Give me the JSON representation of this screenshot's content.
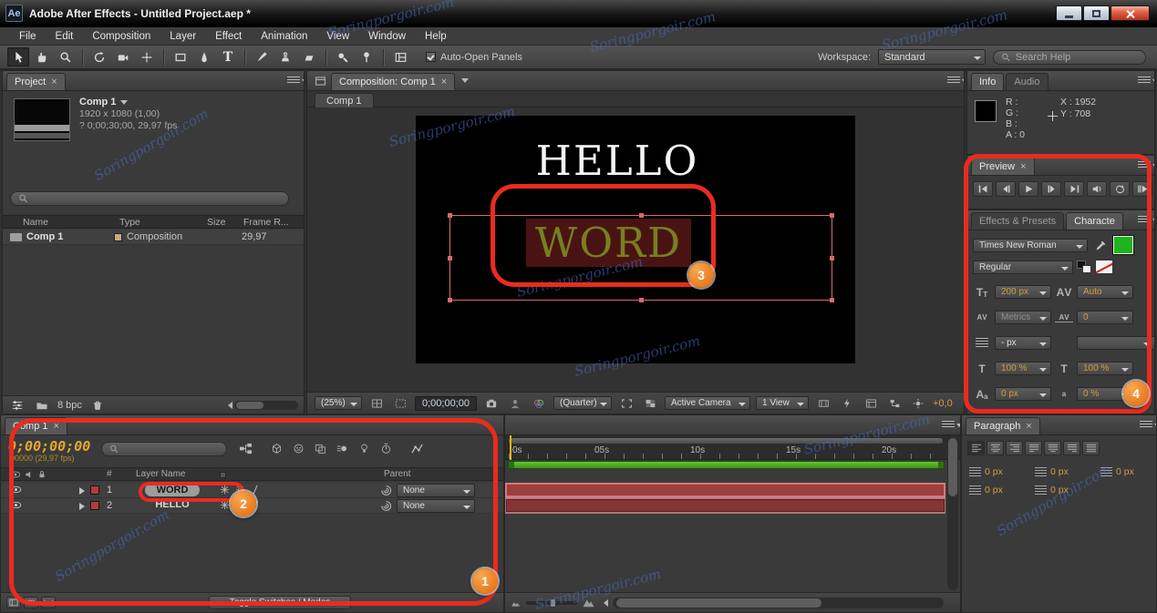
{
  "ui": {
    "close": "×"
  },
  "window": {
    "badge": "Ae",
    "title": "Adobe After Effects - Untitled Project.aep *"
  },
  "menu": {
    "items": [
      "File",
      "Edit",
      "Composition",
      "Layer",
      "Effect",
      "Animation",
      "View",
      "Window",
      "Help"
    ]
  },
  "toolbar": {
    "text_tool": "T",
    "auto_open_label": "Auto-Open Panels",
    "workspace_label": "Workspace:",
    "workspace_value": "Standard",
    "search_placeholder": "Search Help"
  },
  "project": {
    "tab": "Project",
    "comp_name": "Comp 1",
    "detail1": "1920 x 1080 (1,00)",
    "detail2": "? 0;00;30;00, 29,97 fps",
    "col_name": "Name",
    "col_type": "Type",
    "col_size": "Size",
    "col_frame": "Frame R...",
    "row_name": "Comp 1",
    "row_type": "Composition",
    "row_frame_rate": "29,97",
    "bpc": "8 bpc"
  },
  "comp": {
    "tab": "Composition: Comp 1",
    "subtab": "Comp 1",
    "hello": "HELLO",
    "word": "WORD",
    "zoom": "(25%)",
    "timecode": "0;00;00;00",
    "resolution": "(Quarter)",
    "camera": "Active Camera",
    "view": "1 View",
    "exposure": "+0,0"
  },
  "info": {
    "tab": "Info",
    "tab_audio": "Audio",
    "r": "R :",
    "g": "G :",
    "b": "B :",
    "a": "A : 0",
    "x": "X : 1952",
    "y": "Y : 708"
  },
  "preview": {
    "tab": "Preview"
  },
  "character": {
    "tab_effects": "Effects & Presets",
    "tab": "Characte",
    "font_family": "Times New Roman",
    "font_style": "Regular",
    "font_size": "200 px",
    "kerning": "Auto",
    "tracking_mode": "Metrics",
    "tracking": "0",
    "leading": "- px",
    "vertical_scale": "100 %",
    "horizontal_scale": "100 %",
    "baseline_shift": "0 px",
    "tsume": "0 %",
    "icon_t": "T",
    "icon_a": "A",
    "icon_v": "V",
    "icon_a_small": "a"
  },
  "paragraph": {
    "tab": "Paragraph",
    "values": [
      "0 px",
      "0 px",
      "0 px",
      "0 px",
      "0 px"
    ]
  },
  "timeline": {
    "tab": "Comp 1",
    "timecode": "0;00;00;00",
    "frames": "00000 (29,97 fps)",
    "col_hash": "#",
    "col_layer_name": "Layer Name",
    "col_parent": "Parent",
    "layers": [
      {
        "num": "1",
        "name": "WORD",
        "parent": "None"
      },
      {
        "num": "2",
        "name": "HELLO",
        "parent": "None"
      }
    ],
    "toggle_label": "Toggle Switches / Modes",
    "ruler": [
      "0s",
      "05s",
      "10s",
      "15s",
      "20s"
    ]
  },
  "annotations": {
    "n1": "1",
    "n2": "2",
    "n3": "3",
    "n4": "4"
  },
  "watermark": "Soringporgoir.com",
  "colors": {
    "annotation": "#ea2b1f",
    "badge": "#ee8330",
    "word_fill": "#76801f",
    "word_selection": "#4a1313",
    "work_area_green": "#4fae24"
  }
}
